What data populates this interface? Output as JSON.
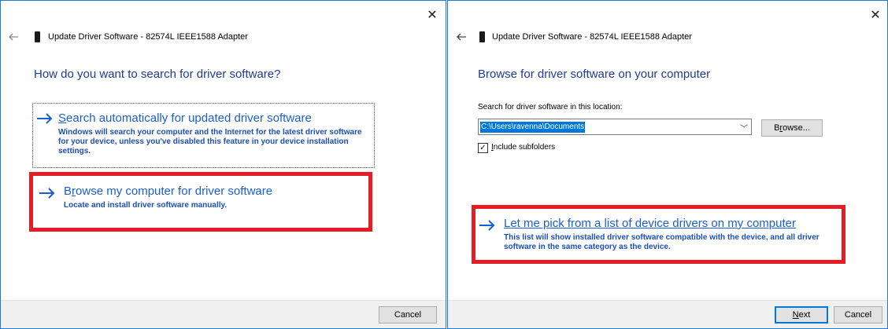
{
  "left": {
    "title": "Update Driver Software - 82574L IEEE1588 Adapter",
    "heading": "How do you want to search for driver software?",
    "option_search": {
      "title_first": "S",
      "title_rest": "earch automatically for updated driver software",
      "desc": "Windows will search your computer and the Internet for the latest driver software for your device, unless you've disabled this feature in your device installation settings."
    },
    "option_browse": {
      "title_first": "B",
      "title_mid": "r",
      "title_rest": "owse my computer for driver software",
      "desc": "Locate and install driver software manually."
    },
    "cancel_label": "Cancel"
  },
  "right": {
    "title": "Update Driver Software - 82574L IEEE1588 Adapter",
    "heading": "Browse for driver software on your computer",
    "location_label": "Search for driver software in this location:",
    "path_value": "C:\\Users\\ravenna\\Documents",
    "browse_first": "B",
    "browse_mid": "r",
    "browse_rest": "owse...",
    "include_first": "I",
    "include_rest": "nclude subfolders",
    "include_checked": true,
    "option_pick": {
      "title_first": "L",
      "title_rest": "et me pick from a list of device drivers on my computer",
      "desc": "This list will show installed driver software compatible with the device, and all driver software in the same category as the device."
    },
    "next_first": "N",
    "next_rest": "ext",
    "cancel_label": "Cancel"
  },
  "colors": {
    "accent": "#1e7ad6",
    "heading": "#1e3c96",
    "link": "#1a5fd1",
    "highlight": "#e51c23"
  }
}
